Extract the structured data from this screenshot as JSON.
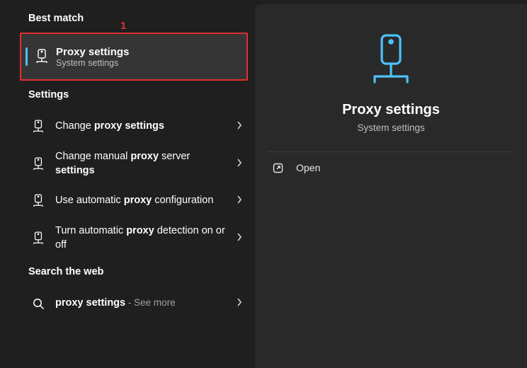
{
  "annotation": "1",
  "sections": {
    "best_match": "Best match",
    "settings": "Settings",
    "search_web": "Search the web"
  },
  "best_match_item": {
    "label": "Proxy settings",
    "sub": "System settings"
  },
  "settings_items": [
    {
      "pre": "Change ",
      "bold": "proxy settings",
      "post": ""
    },
    {
      "pre": "Change manual ",
      "bold": "proxy",
      "post": " server ",
      "bold2": "settings"
    },
    {
      "pre": "Use automatic ",
      "bold": "proxy",
      "post": " configuration"
    },
    {
      "pre": "Turn automatic ",
      "bold": "proxy",
      "post": " detection on or off"
    }
  ],
  "web_item": {
    "bold": "proxy settings",
    "tail": " - See more"
  },
  "preview": {
    "title": "Proxy settings",
    "sub": "System settings"
  },
  "actions": {
    "open": "Open"
  },
  "colors": {
    "accent": "#4cc2ff",
    "highlight_border": "#e03030"
  }
}
